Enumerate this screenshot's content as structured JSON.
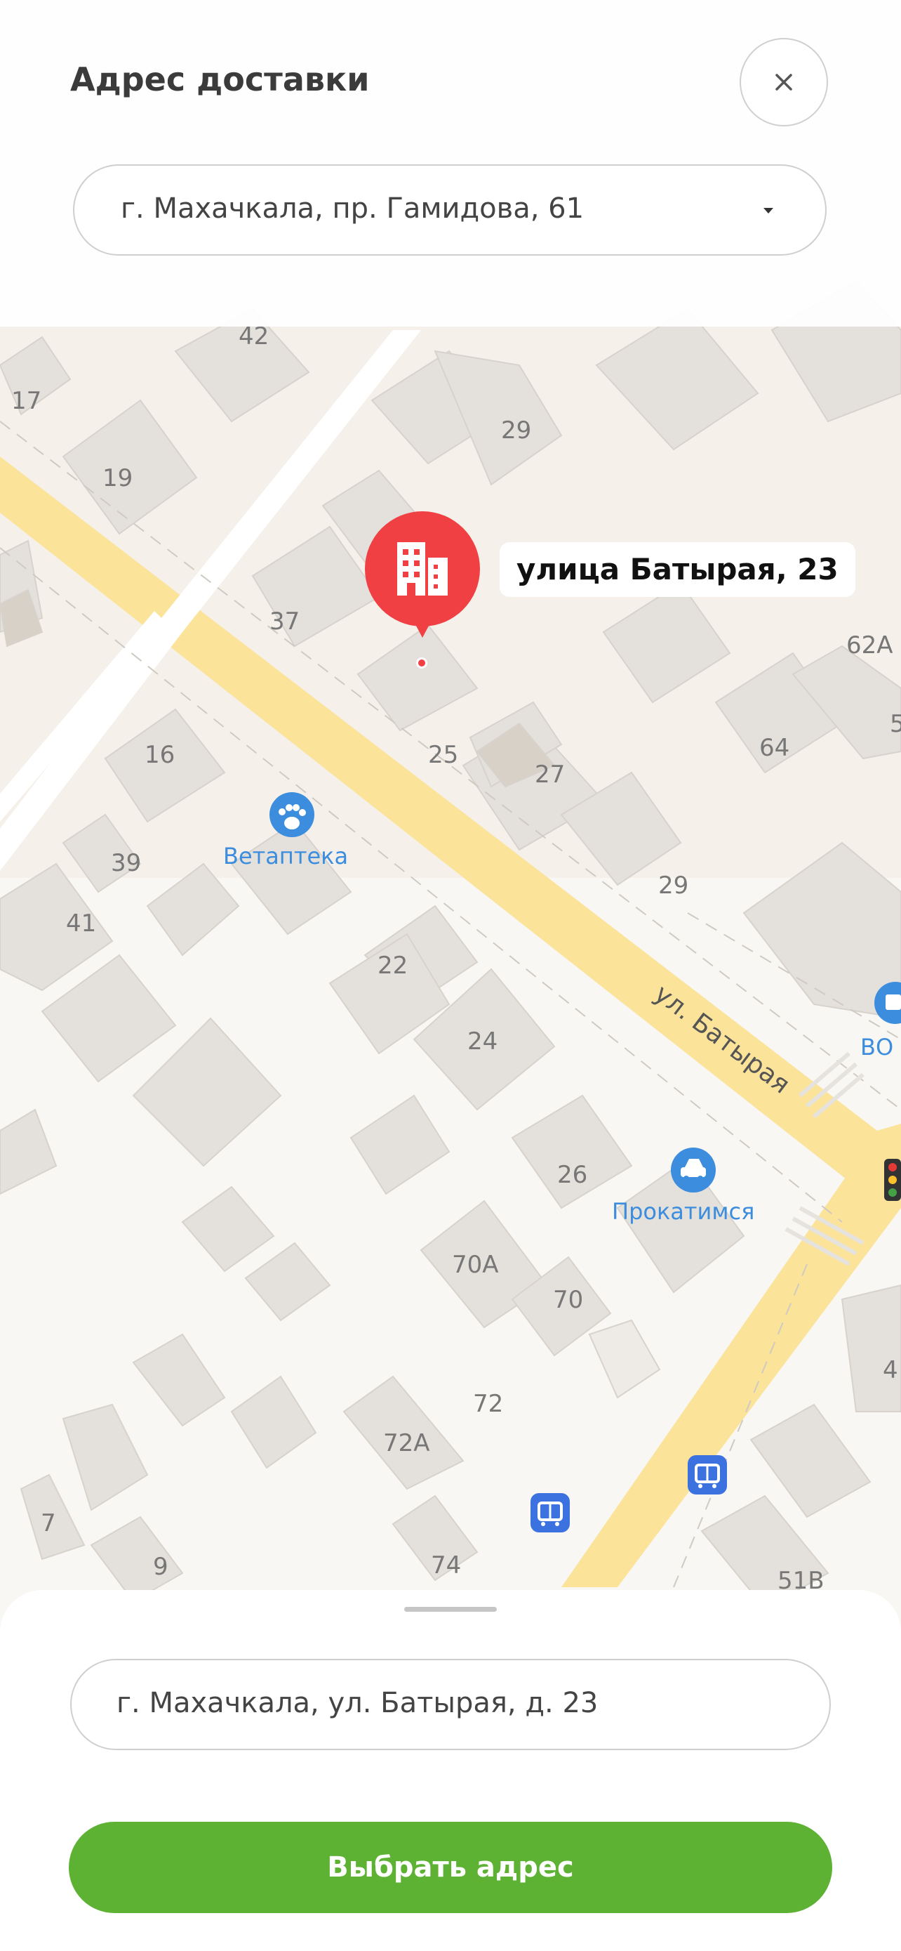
{
  "header": {
    "title": "Адрес доставки",
    "city_value": "г. Махачкала, пр. Гамидова, 61"
  },
  "map": {
    "pin_label": "улица Батырая, 23",
    "street_label": "ул. Батырая",
    "pois": [
      {
        "name": "Ветаптека",
        "icon": "paw-icon",
        "color": "#3c8dde"
      },
      {
        "name": "Прокатимся",
        "icon": "car-icon",
        "color": "#3c8dde"
      },
      {
        "name": "ВО",
        "icon": "shop-icon",
        "color": "#3c8dde"
      }
    ],
    "house_numbers": [
      "42",
      "17",
      "29",
      "19",
      "37",
      "62А",
      "5",
      "16",
      "25",
      "27",
      "64",
      "39",
      "29",
      "41",
      "22",
      "24",
      "26",
      "70А",
      "70",
      "4",
      "72",
      "72А",
      "7",
      "9",
      "74",
      "51В"
    ]
  },
  "sheet": {
    "address_value": "г. Махачкала, ул. Батырая, д. 23",
    "select_label": "Выбрать адрес"
  },
  "colors": {
    "accent_green": "#5db234",
    "pin_red": "#f04044",
    "road_yellow": "#fbe39a",
    "poi_blue": "#3c8dde"
  }
}
